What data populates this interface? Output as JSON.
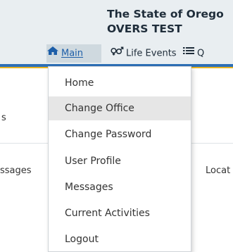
{
  "header": {
    "title_line1": "The State of Orego",
    "title_line2": "OVERS TEST"
  },
  "nav": {
    "main": "Main",
    "life_events": "Life Events",
    "q": "Q"
  },
  "background": {
    "left_col": [
      "s",
      "ssages"
    ],
    "right_col": "Locat"
  },
  "menu": {
    "items": [
      {
        "label": "Home"
      },
      {
        "label": "Change Office"
      },
      {
        "label": "Change Password"
      },
      {
        "label": "User Profile"
      },
      {
        "label": "Messages"
      },
      {
        "label": "Current Activities"
      },
      {
        "label": "Logout"
      }
    ],
    "active_index": 1
  },
  "colors": {
    "accent_blue": "#2d6fb6",
    "accent_yellow": "#e7b323",
    "link_blue": "#1d5ea8"
  },
  "icons": {
    "main": "home-icon",
    "life_events": "gender-icon",
    "q": "list-icon"
  }
}
